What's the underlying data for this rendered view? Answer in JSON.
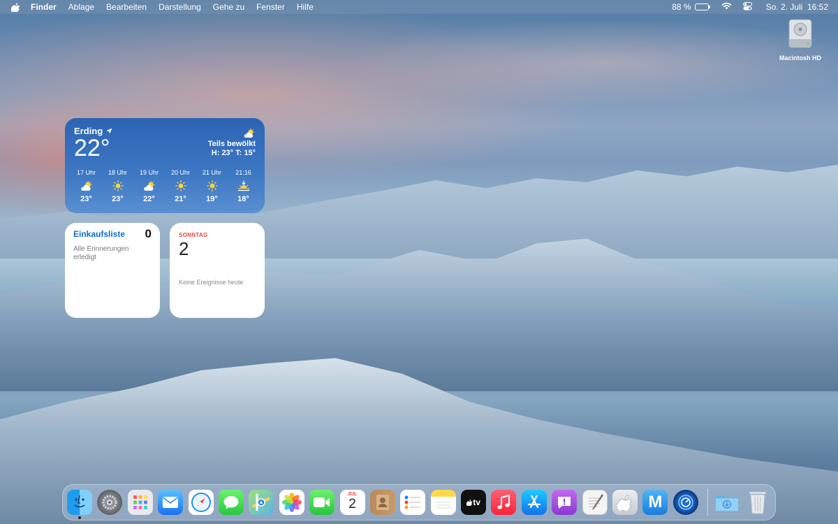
{
  "menubar": {
    "items": [
      "Finder",
      "Ablage",
      "Bearbeiten",
      "Darstellung",
      "Gehe zu",
      "Fenster",
      "Hilfe"
    ],
    "battery_percent": "88 %",
    "battery_level": 0.88,
    "datetime": "So. 2. Juli  16:52"
  },
  "desktop": {
    "drive_label": "Macintosh HD"
  },
  "weather": {
    "location": "Erding",
    "temperature": "22°",
    "condition": "Teils bewölkt",
    "high_low": "H: 23° T: 15°",
    "hourly": [
      {
        "time": "17 Uhr",
        "temp": "23°",
        "icon": "partly-cloudy-icon"
      },
      {
        "time": "18 Uhr",
        "temp": "23°",
        "icon": "sun-icon"
      },
      {
        "time": "19 Uhr",
        "temp": "22°",
        "icon": "partly-cloudy-icon"
      },
      {
        "time": "20 Uhr",
        "temp": "21°",
        "icon": "sun-icon"
      },
      {
        "time": "21 Uhr",
        "temp": "19°",
        "icon": "sun-icon"
      },
      {
        "time": "21:16",
        "temp": "18°",
        "icon": "sunset-icon"
      }
    ]
  },
  "reminders": {
    "title": "Einkaufsliste",
    "count": "0",
    "status": "Alle Erinnerungen erledigt"
  },
  "calendar": {
    "weekday": "SONNTAG",
    "day": "2",
    "events": "Keine Ereignisse heute",
    "dock_month": "JUL",
    "dock_day": "2"
  },
  "dock": {
    "apps": [
      "finder-icon",
      "system-settings-icon",
      "launchpad-icon",
      "mail-icon",
      "safari-icon",
      "messages-icon",
      "maps-icon",
      "photos-icon",
      "facetime-icon",
      "calendar-icon",
      "contacts-icon",
      "reminders-icon",
      "notes-icon",
      "apple-tv-icon",
      "music-icon",
      "app-store-icon",
      "feedback-icon",
      "textedit-icon",
      "apple-support-icon",
      "m-app-icon",
      "network-radar-icon"
    ],
    "tv_label": "tv",
    "m_label": "M"
  }
}
